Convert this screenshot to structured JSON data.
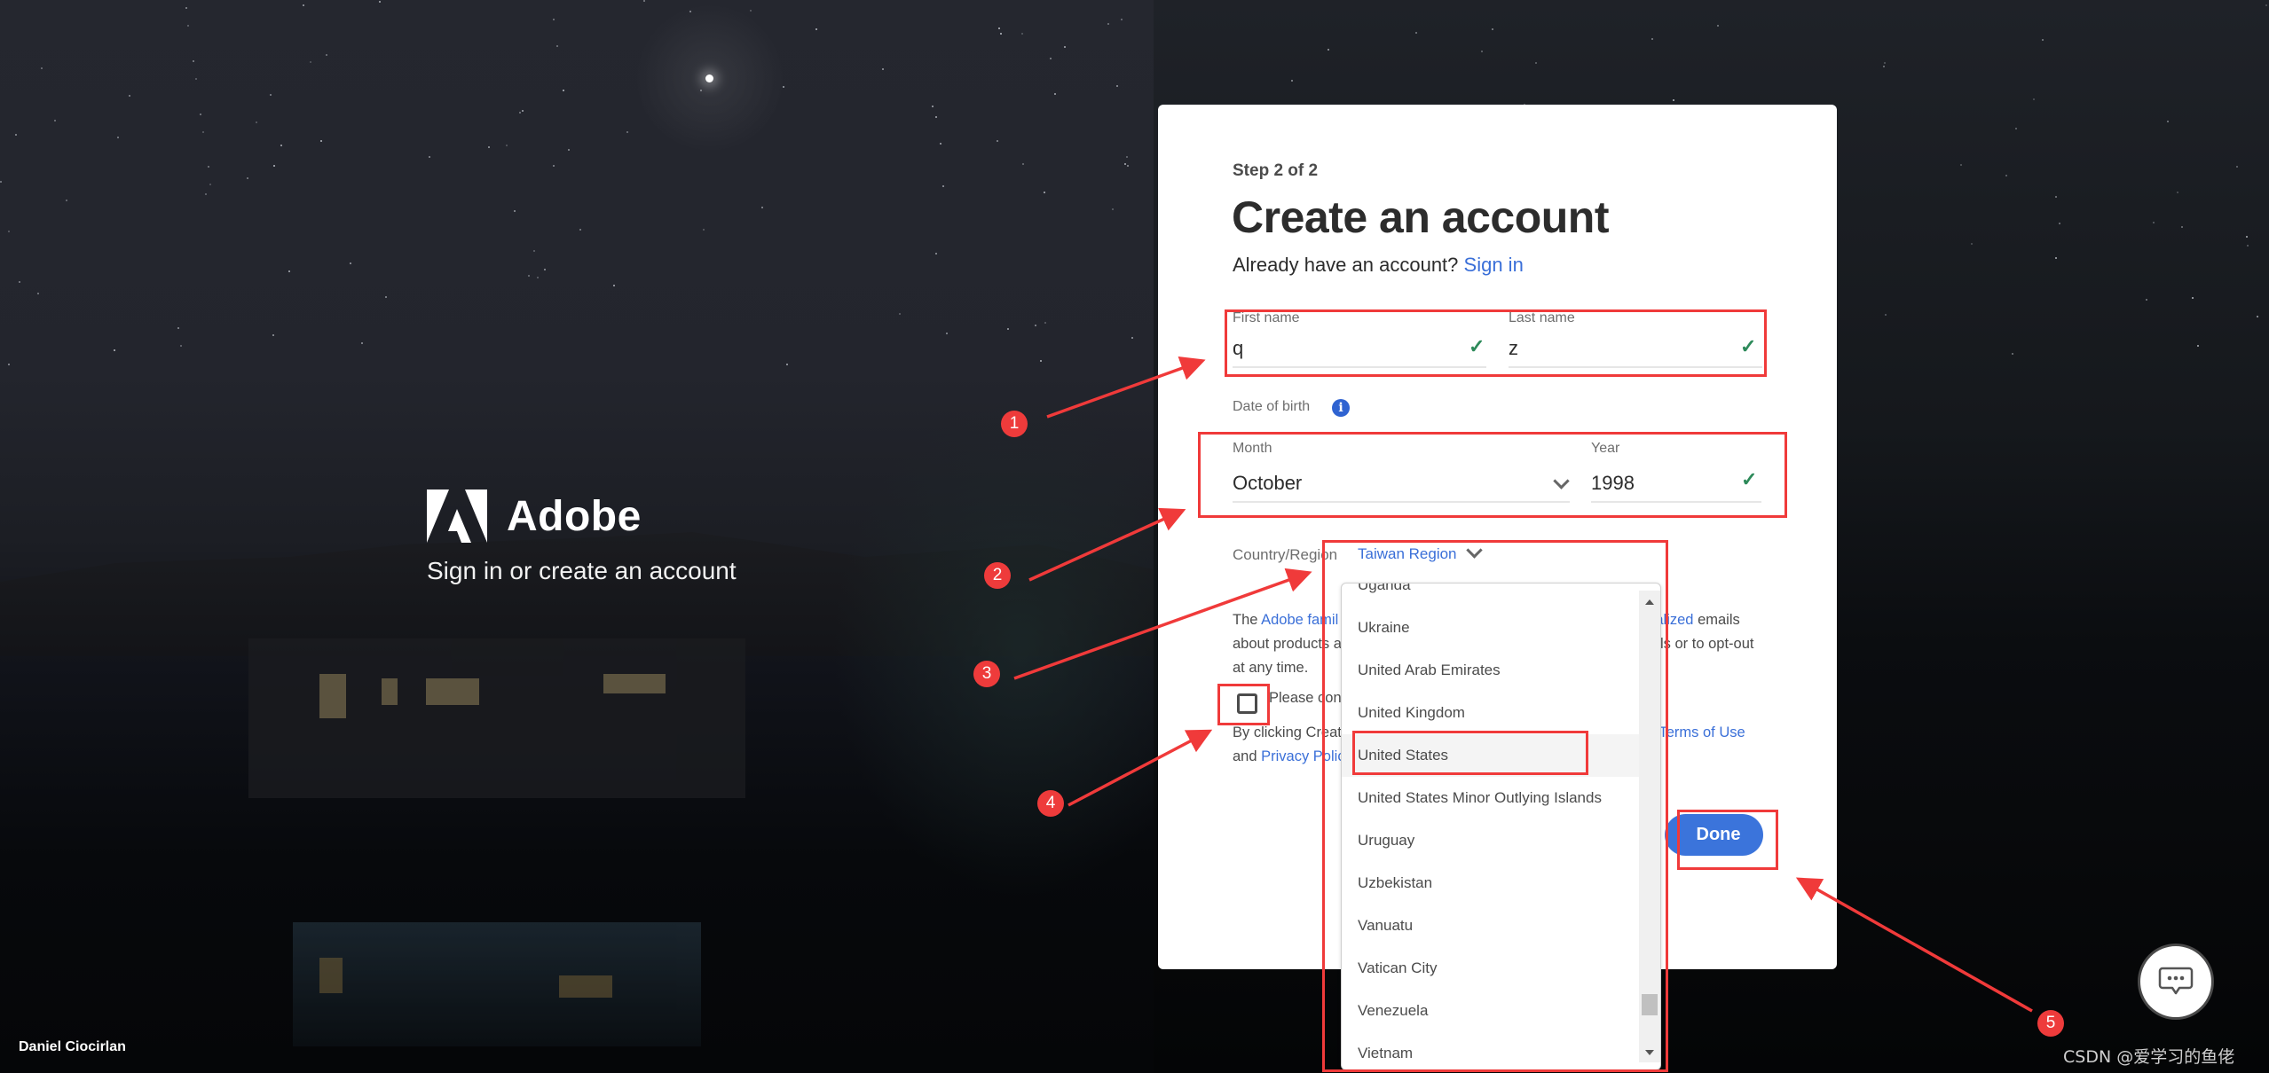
{
  "brand": {
    "name": "Adobe",
    "tagline": "Sign in or create an account",
    "photo_credit": "Daniel Ciocirlan"
  },
  "form": {
    "step": "Step 2 of 2",
    "title": "Create an account",
    "already_text": "Already have an account?",
    "sign_in_link": "Sign in",
    "first_name": {
      "label": "First name",
      "value": "q",
      "valid": true
    },
    "last_name": {
      "label": "Last name",
      "value": "z",
      "valid": true
    },
    "dob_label": "Date of birth",
    "month": {
      "label": "Month",
      "value": "October"
    },
    "year": {
      "label": "Year",
      "value": "1998",
      "valid": true
    },
    "country_label": "Country/Region",
    "country_value": "Taiwan Region",
    "marketing_text": {
      "prefix": "The",
      "link1": "Adobe famil",
      "link2": "onalized",
      "suffix1": "emails",
      "line2_left": "about products a",
      "line2_right": "ls or to opt-out",
      "line3": "at any time."
    },
    "checkbox_label": "Please cont",
    "checkbox_checked": false,
    "terms_text": {
      "line1_left": "By clicking Creat",
      "line1_right_prefix": "e",
      "terms_link": "Terms of Use",
      "line2_prefix": "and",
      "privacy_link": "Privacy Polic"
    },
    "done_button": "Done"
  },
  "country_dropdown": {
    "items": [
      "Uganda",
      "Ukraine",
      "United Arab Emirates",
      "United Kingdom",
      "United States",
      "United States Minor Outlying Islands",
      "Uruguay",
      "Uzbekistan",
      "Vanuatu",
      "Vatican City",
      "Venezuela",
      "Vietnam"
    ],
    "highlighted": "United States",
    "scroll_position_fraction": 0.93
  },
  "annotations": [
    "1",
    "2",
    "3",
    "4",
    "5"
  ],
  "watermark": "CSDN @爱学习的鱼佬",
  "colors": {
    "accent": "#3b74db",
    "link": "#3a6fd8",
    "valid_check": "#2d8a5a",
    "annotation_red": "#f03a3a"
  }
}
